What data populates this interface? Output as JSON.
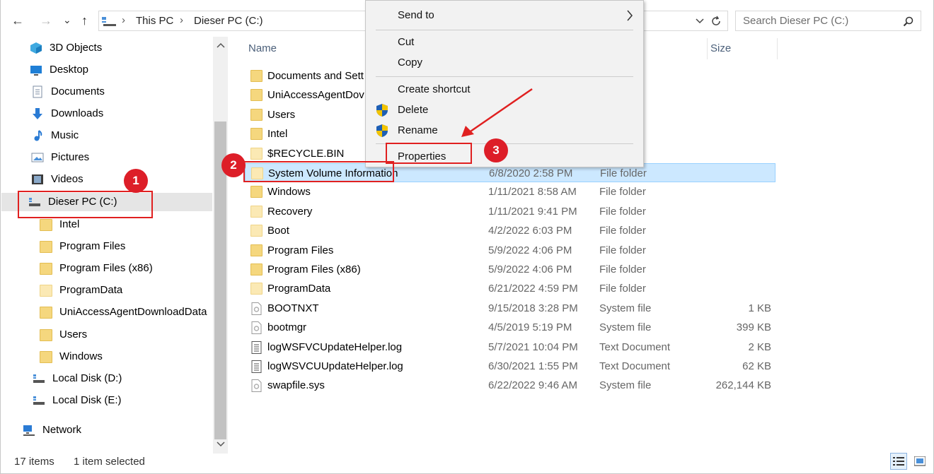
{
  "nav": {
    "back": "←",
    "forward": "→",
    "recent": "⌄",
    "up": "↑"
  },
  "address": {
    "seg1": "This PC",
    "seg2": "Dieser PC (C:)",
    "sep": "›"
  },
  "search": {
    "placeholder": "Search Dieser PC (C:)"
  },
  "tree": [
    {
      "label": "3D Objects",
      "icon": "3d-objects-icon"
    },
    {
      "label": "Desktop",
      "icon": "desktop-icon"
    },
    {
      "label": "Documents",
      "icon": "documents-icon"
    },
    {
      "label": "Downloads",
      "icon": "downloads-icon"
    },
    {
      "label": "Music",
      "icon": "music-icon"
    },
    {
      "label": "Pictures",
      "icon": "pictures-icon"
    },
    {
      "label": "Videos",
      "icon": "videos-icon"
    },
    {
      "label": "Dieser PC (C:)",
      "icon": "drive-icon"
    },
    {
      "label": "Intel",
      "icon": "folder-icon"
    },
    {
      "label": "Program Files",
      "icon": "folder-icon"
    },
    {
      "label": "Program Files (x86)",
      "icon": "folder-icon"
    },
    {
      "label": "ProgramData",
      "icon": "folder-icon"
    },
    {
      "label": "UniAccessAgentDownloadData",
      "icon": "folder-icon"
    },
    {
      "label": "Users",
      "icon": "folder-icon"
    },
    {
      "label": "Windows",
      "icon": "folder-icon"
    },
    {
      "label": "Local Disk (D:)",
      "icon": "drive-icon"
    },
    {
      "label": "Local Disk (E:)",
      "icon": "drive-icon"
    },
    {
      "label": "Network",
      "icon": "network-icon"
    }
  ],
  "columns": {
    "name": "Name",
    "size": "Size"
  },
  "files": [
    {
      "name": "Documents and Sett",
      "date": "",
      "type": "",
      "size": "",
      "kind": "folder"
    },
    {
      "name": "UniAccessAgentDov",
      "date": "",
      "type": "",
      "size": "",
      "kind": "folder"
    },
    {
      "name": "Users",
      "date": "",
      "type": "",
      "size": "",
      "kind": "folder"
    },
    {
      "name": "Intel",
      "date": "",
      "type": "",
      "size": "",
      "kind": "folder"
    },
    {
      "name": "$RECYCLE.BIN",
      "date": "",
      "type": "",
      "size": "",
      "kind": "folder-pale"
    },
    {
      "name": "System Volume Information",
      "date": "6/8/2020 2:58 PM",
      "type": "File folder",
      "size": "",
      "kind": "folder-pale"
    },
    {
      "name": "Windows",
      "date": "1/11/2021 8:58 AM",
      "type": "File folder",
      "size": "",
      "kind": "folder"
    },
    {
      "name": "Recovery",
      "date": "1/11/2021 9:41 PM",
      "type": "File folder",
      "size": "",
      "kind": "folder-pale"
    },
    {
      "name": "Boot",
      "date": "4/2/2022 6:03 PM",
      "type": "File folder",
      "size": "",
      "kind": "folder-pale"
    },
    {
      "name": "Program Files",
      "date": "5/9/2022 4:06 PM",
      "type": "File folder",
      "size": "",
      "kind": "folder"
    },
    {
      "name": "Program Files (x86)",
      "date": "5/9/2022 4:06 PM",
      "type": "File folder",
      "size": "",
      "kind": "folder"
    },
    {
      "name": "ProgramData",
      "date": "6/21/2022 4:59 PM",
      "type": "File folder",
      "size": "",
      "kind": "folder-pale"
    },
    {
      "name": "BOOTNXT",
      "date": "9/15/2018 3:28 PM",
      "type": "System file",
      "size": "1 KB",
      "kind": "file"
    },
    {
      "name": "bootmgr",
      "date": "4/5/2019 5:19 PM",
      "type": "System file",
      "size": "399 KB",
      "kind": "file"
    },
    {
      "name": "logWSFVCUpdateHelper.log",
      "date": "5/7/2021 10:04 PM",
      "type": "Text Document",
      "size": "2 KB",
      "kind": "text"
    },
    {
      "name": "logWSVCUUpdateHelper.log",
      "date": "6/30/2021 1:55 PM",
      "type": "Text Document",
      "size": "62 KB",
      "kind": "text"
    },
    {
      "name": "swapfile.sys",
      "date": "6/22/2022 9:46 AM",
      "type": "System file",
      "size": "262,144 KB",
      "kind": "file"
    }
  ],
  "context_menu": {
    "send_to": "Send to",
    "cut": "Cut",
    "copy": "Copy",
    "create_shortcut": "Create shortcut",
    "delete": "Delete",
    "rename": "Rename",
    "properties": "Properties"
  },
  "annotations": {
    "step1": "1",
    "step2": "2",
    "step3": "3"
  },
  "status": {
    "count": "17 items",
    "selected": "1 item selected"
  },
  "colors": {
    "annotation_red": "#dd1e28",
    "selection_blue": "#cce8ff"
  }
}
